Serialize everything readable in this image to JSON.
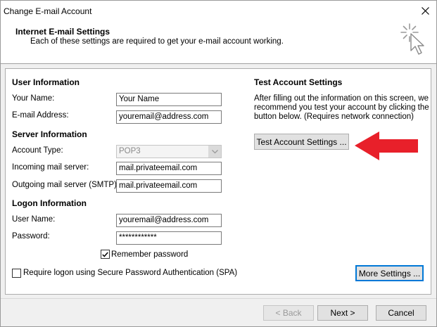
{
  "window": {
    "title": "Change E-mail Account"
  },
  "header": {
    "title": "Internet E-mail Settings",
    "subtitle": "Each of these settings are required to get your e-mail account working."
  },
  "user_info": {
    "heading": "User Information",
    "name_label": "Your Name:",
    "name_value": "Your Name",
    "email_label": "E-mail Address:",
    "email_value": "youremail@address.com"
  },
  "server_info": {
    "heading": "Server Information",
    "account_type_label": "Account Type:",
    "account_type_value": "POP3",
    "incoming_label": "Incoming mail server:",
    "incoming_value": "mail.privateemail.com",
    "outgoing_label": "Outgoing mail server (SMTP):",
    "outgoing_value": "mail.privateemail.com"
  },
  "logon_info": {
    "heading": "Logon Information",
    "username_label": "User Name:",
    "username_value": "youremail@address.com",
    "password_label": "Password:",
    "password_value": "************",
    "remember_label": "Remember password",
    "remember_checked": true,
    "spa_label": "Require logon using Secure Password Authentication (SPA)",
    "spa_checked": false
  },
  "test_settings": {
    "heading": "Test Account Settings",
    "description_line1": "After filling out the information on this screen, we",
    "description_line2": "recommend you test your account by clicking the",
    "description_line3": "button below. (Requires network connection)",
    "test_button_label": "Test Account Settings ...",
    "more_settings_label": "More Settings ..."
  },
  "footer": {
    "back_label": "< Back",
    "next_label": "Next >",
    "cancel_label": "Cancel"
  },
  "colors": {
    "annotation_arrow": "#e8202a",
    "focus_border": "#0078d7"
  },
  "icons": {
    "close": "close-icon",
    "cursor": "cursor-sparkle-icon",
    "arrow": "red-arrow-annotation",
    "dropdown": "chevron-down-icon",
    "check": "checkmark-icon"
  }
}
